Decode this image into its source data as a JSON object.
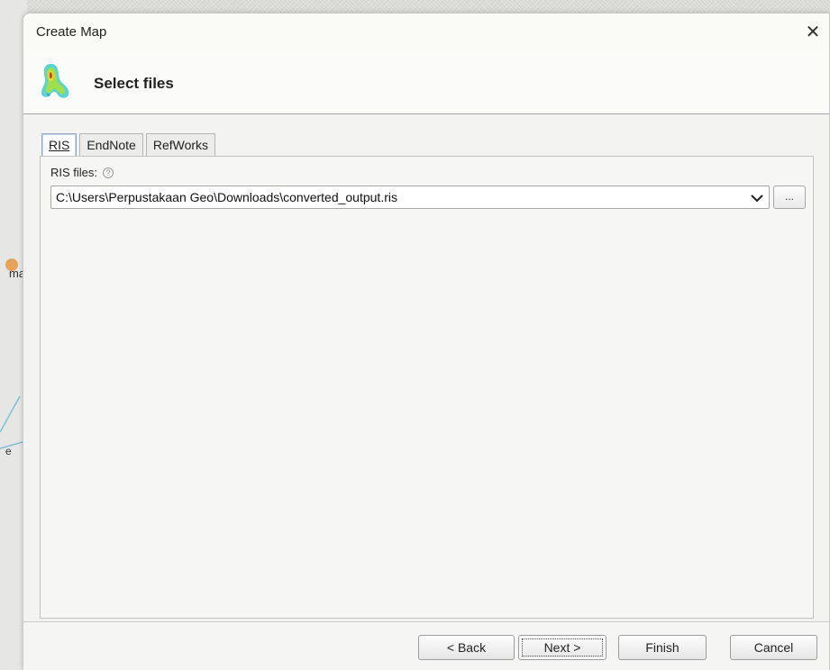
{
  "background": {
    "side_text": "ma",
    "side_text2": "e"
  },
  "dialog": {
    "title": "Create Map",
    "close_glyph": "✕"
  },
  "header": {
    "title": "Select files",
    "icon": "density-map-icon"
  },
  "tabs": [
    {
      "label": "RIS",
      "active": true
    },
    {
      "label": "EndNote",
      "active": false
    },
    {
      "label": "RefWorks",
      "active": false
    }
  ],
  "ris": {
    "label": "RIS files:",
    "help_glyph": "?",
    "path": "C:\\Users\\Perpustakaan Geo\\Downloads\\converted_output.ris",
    "browse_label": "..."
  },
  "footer": {
    "back_label": "< Back",
    "next_label": "Next >",
    "finish_label": "Finish",
    "cancel_label": "Cancel"
  },
  "colors": {
    "dialog_bg": "#f7f7f6",
    "active_tab_border": "#8fa6c6",
    "bg_dot": "#e7a35a"
  }
}
